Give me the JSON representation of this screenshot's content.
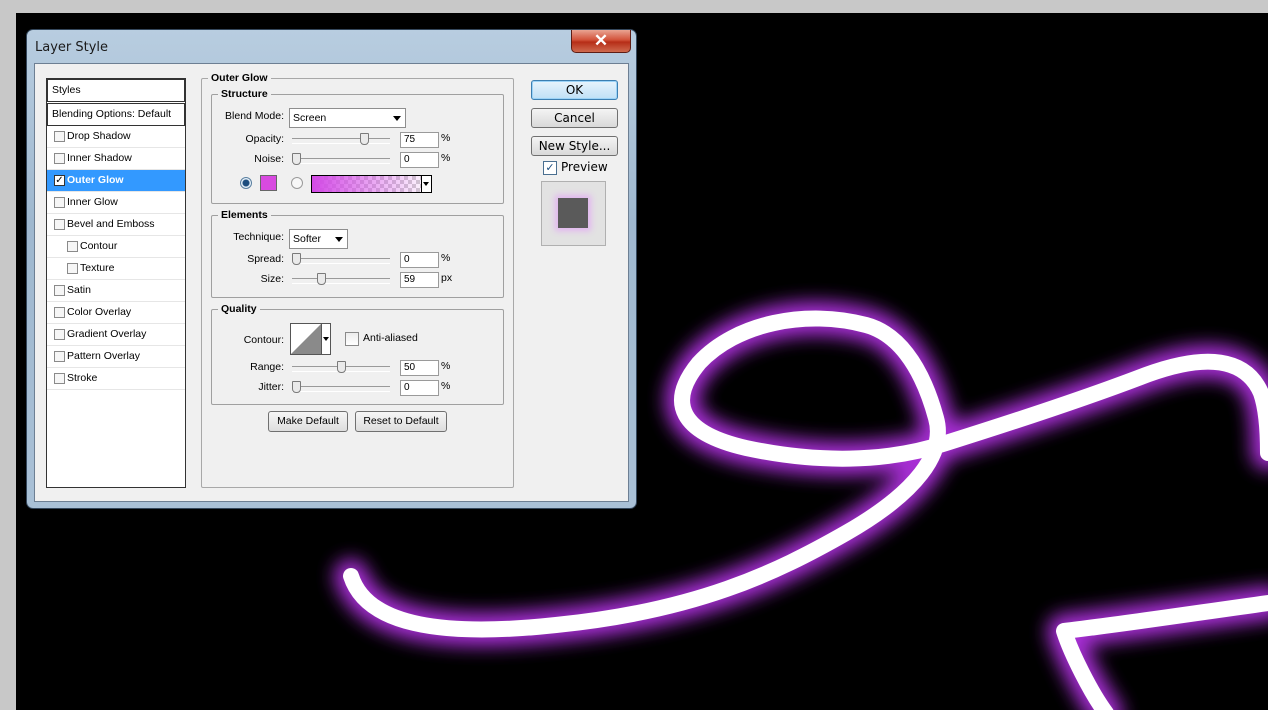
{
  "dialog": {
    "title": "Layer Style",
    "close_glyph": "✕"
  },
  "styles_list": {
    "header": "Styles",
    "blending": "Blending Options: Default",
    "items": [
      {
        "label": "Drop Shadow",
        "checked": false,
        "indent": false
      },
      {
        "label": "Inner Shadow",
        "checked": false,
        "indent": false
      },
      {
        "label": "Outer Glow",
        "checked": true,
        "indent": false,
        "selected": true
      },
      {
        "label": "Inner Glow",
        "checked": false,
        "indent": false
      },
      {
        "label": "Bevel and Emboss",
        "checked": false,
        "indent": false
      },
      {
        "label": "Contour",
        "checked": false,
        "indent": true
      },
      {
        "label": "Texture",
        "checked": false,
        "indent": true
      },
      {
        "label": "Satin",
        "checked": false,
        "indent": false
      },
      {
        "label": "Color Overlay",
        "checked": false,
        "indent": false
      },
      {
        "label": "Gradient Overlay",
        "checked": false,
        "indent": false
      },
      {
        "label": "Pattern Overlay",
        "checked": false,
        "indent": false
      },
      {
        "label": "Stroke",
        "checked": false,
        "indent": false
      }
    ]
  },
  "panel": {
    "title": "Outer Glow",
    "structure": {
      "legend": "Structure",
      "blend_mode_label": "Blend Mode:",
      "blend_mode_value": "Screen",
      "opacity_label": "Opacity:",
      "opacity_value": "75",
      "opacity_unit": "%",
      "opacity_level": 0.75,
      "noise_label": "Noise:",
      "noise_value": "0",
      "noise_unit": "%",
      "noise_level": 0,
      "glow_color": "#d84ae0"
    },
    "elements": {
      "legend": "Elements",
      "technique_label": "Technique:",
      "technique_value": "Softer",
      "spread_label": "Spread:",
      "spread_value": "0",
      "spread_unit": "%",
      "spread_level": 0,
      "size_label": "Size:",
      "size_value": "59",
      "size_unit": "px",
      "size_level": 0.28
    },
    "quality": {
      "legend": "Quality",
      "contour_label": "Contour:",
      "anti_aliased_label": "Anti-aliased",
      "range_label": "Range:",
      "range_value": "50",
      "range_unit": "%",
      "range_level": 0.5,
      "jitter_label": "Jitter:",
      "jitter_value": "0",
      "jitter_unit": "%",
      "jitter_level": 0
    },
    "make_default": "Make Default",
    "reset_default": "Reset to Default"
  },
  "buttons": {
    "ok": "OK",
    "cancel": "Cancel",
    "new_style": "New Style...",
    "preview_label": "Preview",
    "preview_checked": true
  },
  "colors": {
    "glow": "#c43cf0",
    "canvas": "#000000"
  }
}
